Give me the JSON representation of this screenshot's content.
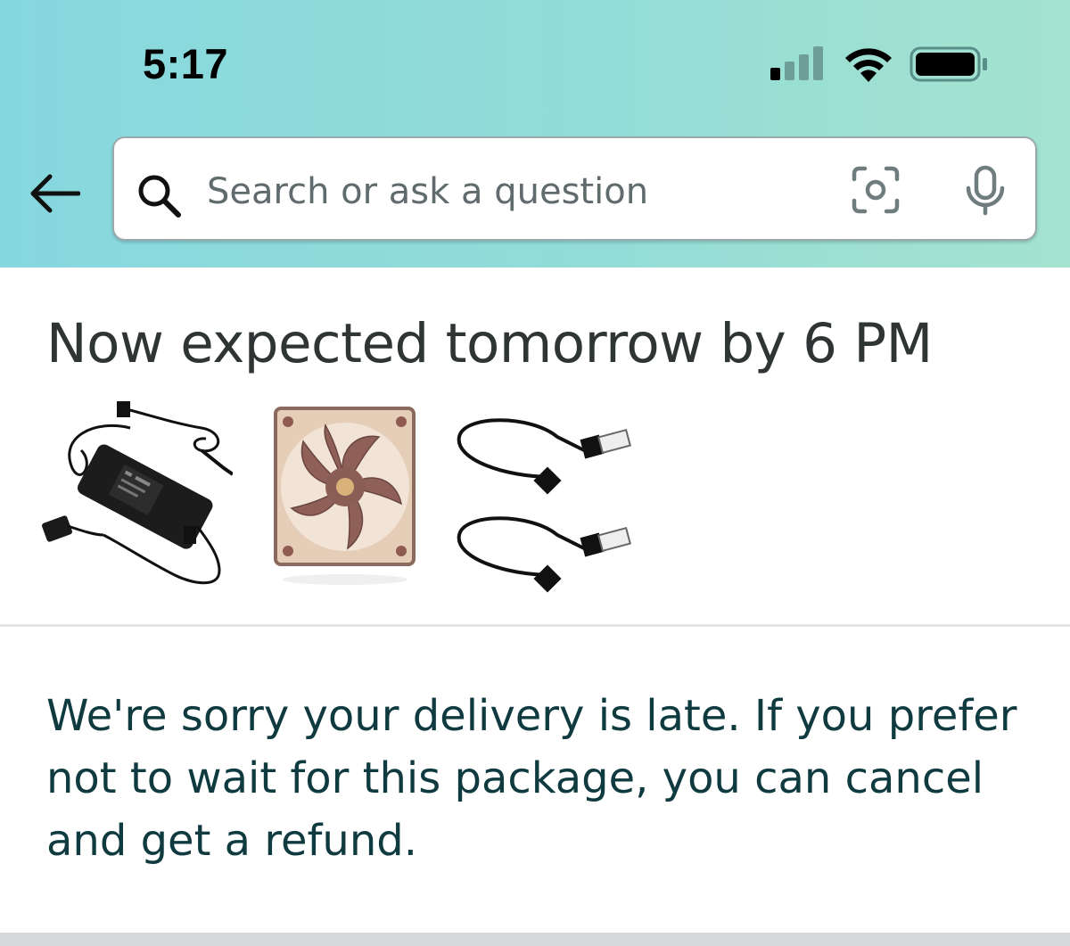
{
  "status_bar": {
    "time": "5:17"
  },
  "search": {
    "placeholder": "Search or ask a question"
  },
  "delivery": {
    "heading": "Now expected tomorrow by 6 PM",
    "items": [
      {
        "name": "power-adapter"
      },
      {
        "name": "case-fan"
      },
      {
        "name": "usb-fan-cables"
      }
    ],
    "message": "We're sorry your delivery is late. If you prefer not to wait for this package, you can cancel and get a refund."
  },
  "colors": {
    "header_start": "#86d8df",
    "header_end": "#a4e3cf",
    "message_text": "#0f3a3f",
    "heading_text": "#2f3435"
  },
  "icons": [
    "back-arrow-icon",
    "search-icon",
    "camera-scan-icon",
    "microphone-icon",
    "cellular-signal-icon",
    "wifi-icon",
    "battery-icon"
  ]
}
